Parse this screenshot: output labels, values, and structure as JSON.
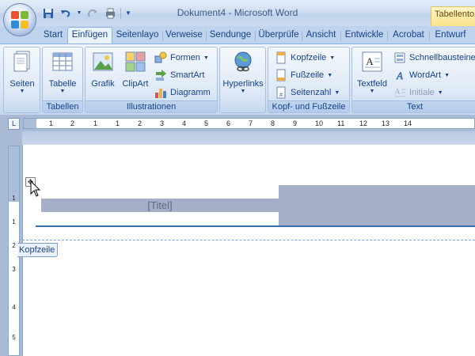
{
  "window": {
    "title": "Dokument4 - Microsoft Word",
    "context_tab_header": "Tabellento"
  },
  "qat": {
    "icons": [
      "save-icon",
      "undo-icon",
      "redo-icon",
      "print-preview-icon",
      "customize-dropdown-icon"
    ]
  },
  "tabs": [
    {
      "label": "Start",
      "active": false
    },
    {
      "label": "Einfügen",
      "active": true
    },
    {
      "label": "Seitenlayo",
      "active": false
    },
    {
      "label": "Verweise",
      "active": false
    },
    {
      "label": "Sendunge",
      "active": false
    },
    {
      "label": "Überprüfe",
      "active": false
    },
    {
      "label": "Ansicht",
      "active": false
    },
    {
      "label": "Entwickle",
      "active": false
    },
    {
      "label": "Acrobat",
      "active": false
    },
    {
      "label": "Entwurf",
      "active": false
    }
  ],
  "ribbon": {
    "seiten": {
      "button": "Seiten"
    },
    "tabellen": {
      "button": "Tabelle",
      "label": "Tabellen"
    },
    "illustrationen": {
      "grafik": "Grafik",
      "clipart": "ClipArt",
      "formen": "Formen",
      "smartart": "SmartArt",
      "diagramm": "Diagramm",
      "label": "Illustrationen"
    },
    "hyperlinks": {
      "button": "Hyperlinks"
    },
    "kopf_fuss": {
      "kopfzeile": "Kopfzeile",
      "fusszeile": "Fußzeile",
      "seitenzahl": "Seitenzahl",
      "label": "Kopf- und Fußzeile"
    },
    "text": {
      "textfeld": "Textfeld",
      "schnellbausteine": "Schnellbausteine",
      "wordart": "WordArt",
      "initiale": "Initiale",
      "label": "Text"
    }
  },
  "ruler": {
    "corner_symbol": "L",
    "h_ticks": [
      "1",
      "2",
      "1",
      "1",
      "2",
      "3",
      "4",
      "5",
      "6",
      "7",
      "8",
      "9",
      "10",
      "11",
      "12",
      "13",
      "14"
    ],
    "v_ticks": [
      "1",
      "1",
      "2",
      "3",
      "4",
      "5"
    ]
  },
  "document": {
    "title_placeholder": "[Titel]",
    "header_tag": "Kopfzeile",
    "move_handle_symbol": "✥"
  },
  "colors": {
    "accent": "#15428b",
    "active_tab": "#eaf2fc",
    "header_field": "#a6afc8",
    "header_rule": "#3b6fb3"
  }
}
